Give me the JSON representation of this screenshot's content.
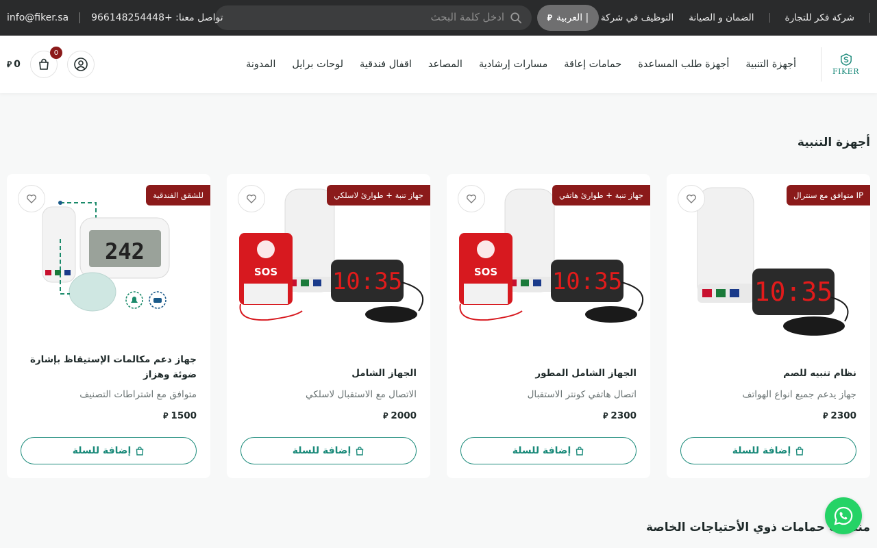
{
  "topbar": {
    "links": [
      "شركة فكر للتجارة",
      "الضمان و الصيانة",
      "التوظيف في شركة فكر"
    ],
    "language_label": "العربية |",
    "search_placeholder": "ادخل كلمة البحث",
    "phone_label": "تواصل معنا: +966148254448",
    "email": "info@fiker.sa"
  },
  "header": {
    "logo_text": "FIKER",
    "nav": [
      "أجهزة التنبية",
      "أجهزة طلب المساعدة",
      "حمامات إعاقة",
      "مسارات إرشادية",
      "المصاعد",
      "اقفال فندقية",
      "لوحات برايل",
      "المدونة"
    ],
    "cart_count": "0",
    "cart_total": "0"
  },
  "section": {
    "title": "أجهزة التنبية"
  },
  "products": [
    {
      "tag": "متوافق مع سنترال IP",
      "title": "نظام تنبيه للصم",
      "subtitle": "جهاز يدعم جميع انواع الهواتف",
      "price": "2300",
      "button": "إضافة للسلة",
      "image_icon": "alarm-lamp-clock-shaker"
    },
    {
      "tag": "جهاز تنبة + طوارئ هاتفي",
      "title": "الجهاز الشامل المطور",
      "subtitle": "اتصال هاتفي كونتر الاستقبال",
      "price": "2300",
      "button": "إضافة للسلة",
      "image_icon": "sos-lamp-clock-shaker"
    },
    {
      "tag": "جهاز تنبة + طوارئ لاسلكي",
      "title": "الجهاز الشامل",
      "subtitle": "الاتصال مع الاستقبال لاسلكي",
      "price": "2000",
      "button": "إضافة للسلة",
      "image_icon": "sos-lamp-clock-shaker"
    },
    {
      "tag": "للشقق الفندقية",
      "title": "جهاز دعم مكالمات الإستيقاظ بإشارة ضوئة وهزاز",
      "subtitle": "متوافق مع اشتراطات التصنيف",
      "price": "1500",
      "button": "إضافة للسلة",
      "image_icon": "lcd-clock-lamp-pad"
    }
  ],
  "section2": {
    "title": "منتجات حمامات ذوي الأحتياجات الخاصة"
  },
  "colors": {
    "topbar_bg": "#2a2b2c",
    "accent": "#1a8a7a",
    "tag_bg": "#8b1a1a",
    "whatsapp": "#25d366"
  }
}
